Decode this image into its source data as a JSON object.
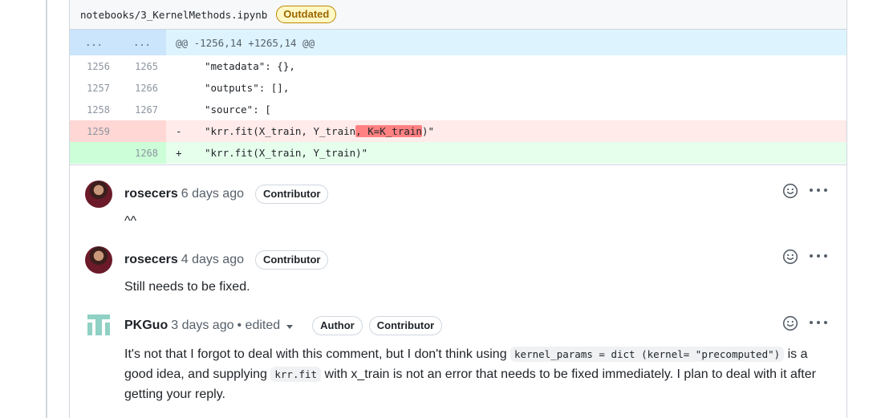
{
  "file": {
    "path": "notebooks/3_KernelMethods.ipynb",
    "status_badge": "Outdated"
  },
  "diff": {
    "hunk": {
      "old": "...",
      "new": "...",
      "header": "@@ -1256,14 +1265,14 @@"
    },
    "lines": [
      {
        "old": "1256",
        "new": "1265",
        "text": "\"metadata\": {},"
      },
      {
        "old": "1257",
        "new": "1266",
        "text": "\"outputs\": [],"
      },
      {
        "old": "1258",
        "new": "1267",
        "text": "\"source\": ["
      },
      {
        "old": "1259",
        "new": "",
        "sign": "-",
        "text_before": "\"krr.fit(X_train, Y_train",
        "text_removed": ", K=K_train",
        "text_after": ")\""
      },
      {
        "old": "",
        "new": "1268",
        "sign": "+",
        "text": "\"krr.fit(X_train, Y_train)\""
      }
    ]
  },
  "comments": [
    {
      "author": "rosecers",
      "time": "6 days ago",
      "labels": [
        "Contributor"
      ],
      "body": "^^"
    },
    {
      "author": "rosecers",
      "time": "4 days ago",
      "labels": [
        "Contributor"
      ],
      "body": "Still needs to be fixed."
    },
    {
      "author": "PKGuo",
      "time": "3 days ago",
      "edited": "• edited",
      "labels": [
        "Author",
        "Contributor"
      ],
      "body_parts": {
        "p1": "It's not that I forgot to deal with this comment, but I don't think using ",
        "code1": "kernel_params = dict (kernel= \"precomputed\")",
        "p2": " is a good idea, and supplying ",
        "code2": "krr.fit",
        "p3": " with x_train is not an error that needs to be fixed immediately. I plan to deal with it after getting your reply."
      }
    }
  ],
  "icons": {
    "reaction": "smiley-icon",
    "more": "kebab-horizontal-icon"
  },
  "colors": {
    "deletion_bg": "#ffebe9",
    "addition_bg": "#e6ffec",
    "hunk_bg": "#ddf4ff",
    "outdated": "#9a6700"
  }
}
